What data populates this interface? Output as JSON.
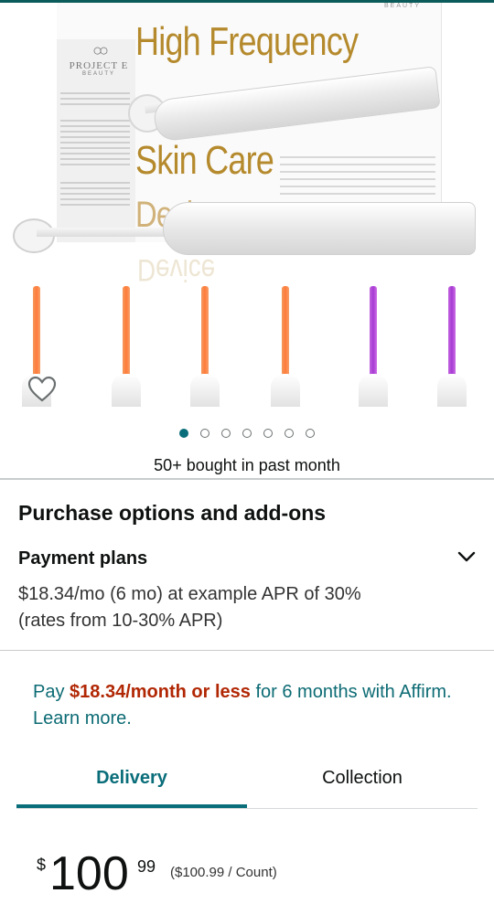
{
  "product_image": {
    "brand_logo_text": "PROJECT E",
    "brand_sub": "BEAUTY",
    "box_top_brand": "BEAUTY",
    "headline_line1": "High Frequency",
    "headline_line2": "Skin Care",
    "headline_line3": "Device"
  },
  "carousel": {
    "count": 7,
    "active_index": 0
  },
  "social_proof": {
    "text": "50+ bought in past month"
  },
  "purchase_options": {
    "title": "Purchase options and add-ons"
  },
  "payment_plans": {
    "title": "Payment plans",
    "description": "$18.34/mo (6 mo) at example APR of 30% (rates from 10-30% APR)"
  },
  "affirm": {
    "prefix": "Pay ",
    "amount": "$18.34/month or less",
    "suffix": " for 6 months with Affirm. Learn more."
  },
  "tabs": {
    "delivery": "Delivery",
    "collection": "Collection",
    "active": "delivery"
  },
  "price": {
    "currency": "$",
    "whole": "100",
    "fraction": "99",
    "unit_price": "($100.99 / Count)"
  },
  "colors": {
    "accent_teal": "#0a6e7a",
    "price_red": "#b12704",
    "headline_gold": "#b58a2d"
  }
}
